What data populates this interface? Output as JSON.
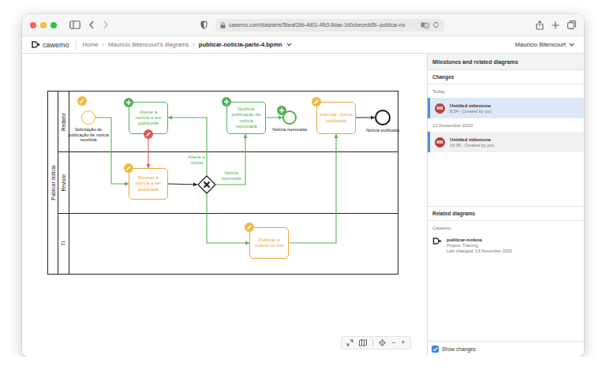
{
  "browser": {
    "url": "cawemo.com/diagrams/5beaf2bb-4d01-4fb3-8dae-1d0cbecedd5f--publicar-no"
  },
  "header": {
    "logo": "cawemo",
    "breadcrumbs": [
      {
        "label": "Home",
        "current": false
      },
      {
        "label": "Mauricio Bitencourt's diagrams",
        "current": false
      },
      {
        "label": "publicar-noticia-parte-4.bpmn",
        "current": true
      }
    ],
    "separator": "›",
    "user": "Mauricio Bitencourt"
  },
  "diagram": {
    "pool": "Publicar notícia",
    "lanes": [
      "Redator",
      "Revisor",
      "TI"
    ],
    "nodes": [
      {
        "kind": "start",
        "label": "Solicitação de publicação de notícia recebida",
        "color": "#f0b43c",
        "badges": [
          {
            "kind": "edit",
            "color": "#f2b93f"
          }
        ]
      },
      {
        "kind": "task",
        "label": "Alterar a notícia a ser publicada",
        "color": "#52b157",
        "badges": [
          {
            "kind": "add",
            "color": "#52b157"
          },
          {
            "kind": "edit",
            "color": "#e0585b"
          }
        ]
      },
      {
        "kind": "task",
        "label": "Revisar a notícia a ser publicada",
        "color": "#eea43a",
        "badges": [
          {
            "kind": "edit",
            "color": "#f2b93f"
          }
        ]
      },
      {
        "kind": "gateway",
        "color": "#222222",
        "badges": []
      },
      {
        "kind": "task",
        "label": "Notificar publicação de notícia reprovada",
        "color": "#52b157",
        "badges": [
          {
            "kind": "add",
            "color": "#52b157"
          }
        ]
      },
      {
        "kind": "end",
        "label": "Notícia reprovada",
        "color": "#52b157",
        "badges": [
          {
            "kind": "add",
            "color": "#52b157"
          }
        ]
      },
      {
        "kind": "task",
        "label": "Informar notícia publicada",
        "color": "#eea43a",
        "badges": [
          {
            "kind": "edit",
            "color": "#f2b93f"
          }
        ]
      },
      {
        "kind": "end",
        "label": "Notícia publicada",
        "color": "#111111",
        "badges": []
      },
      {
        "kind": "task",
        "label": "Publicar a notícia no site",
        "color": "#eea43a",
        "badges": [
          {
            "kind": "edit",
            "color": "#f2b93f"
          }
        ]
      }
    ],
    "flows": [
      {
        "color": "#52b157"
      },
      {
        "color": "#52b157",
        "label": "Alterar a notícia"
      },
      {
        "color": "#e0585b"
      },
      {
        "color": "#222222"
      },
      {
        "color": "#52b157",
        "label": "Notícia reprovada"
      },
      {
        "color": "#52b157"
      },
      {
        "color": "#52b157"
      },
      {
        "color": "#52b157"
      },
      {
        "color": "#222222"
      }
    ]
  },
  "zoom": {
    "out": "−",
    "in": "+"
  },
  "panel": {
    "title": "Milestones and related diagrams",
    "changes_heading": "Changes",
    "groups": [
      {
        "date": "Today",
        "milestones": [
          {
            "avatar": "MB",
            "title": "Untitled milestone",
            "meta": "8:34 - Created by you",
            "selected": true
          }
        ]
      },
      {
        "date": "13 November 2020",
        "milestones": [
          {
            "avatar": "MB",
            "title": "Untitled milestone",
            "meta": "19:35 - Created by you",
            "selected": false
          }
        ]
      }
    ],
    "related_heading": "Related diagrams",
    "related_source": "Cawemo",
    "related": [
      {
        "name": "publicar-noticia",
        "project": "Project: Training",
        "changed": "Last changed: 13 November 2020"
      }
    ],
    "show_changes": {
      "label": "Show changes",
      "checked": true
    }
  }
}
